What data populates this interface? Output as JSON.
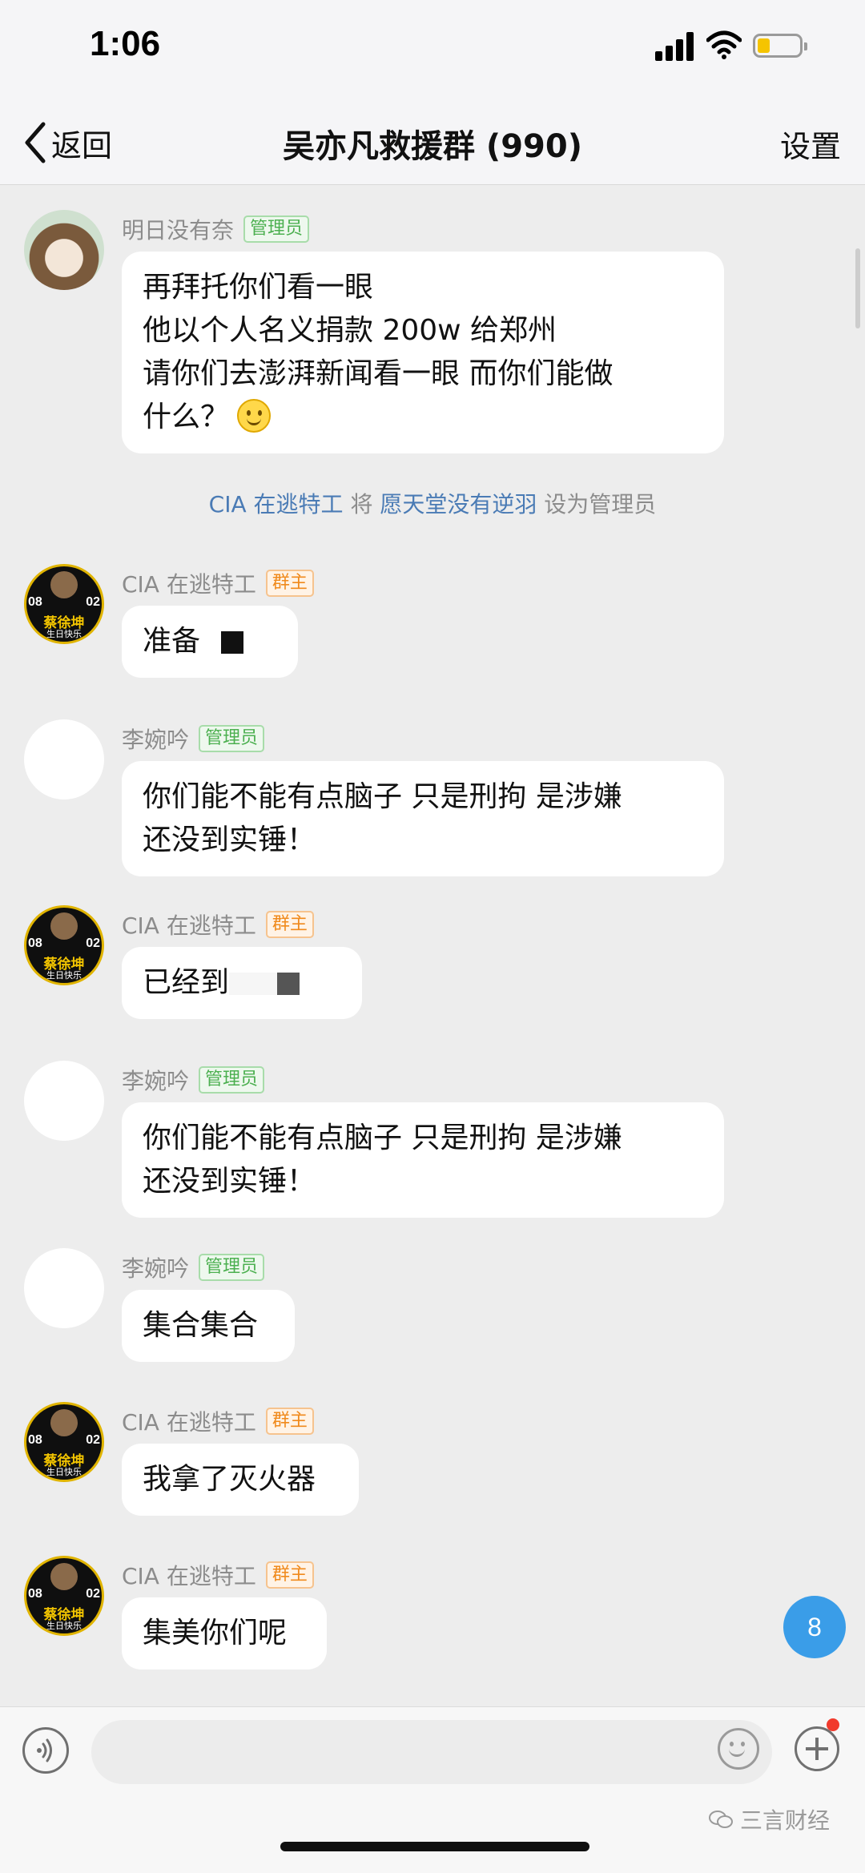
{
  "status_bar": {
    "time": "1:06"
  },
  "nav": {
    "back_label": "返回",
    "title": "吴亦凡救援群 (990)",
    "settings_label": "设置"
  },
  "badges": {
    "admin": "管理员",
    "owner": "群主"
  },
  "avatar_poster": {
    "left_num": "08",
    "right_num": "02",
    "name": "蔡徐坤",
    "sub": "生日快乐"
  },
  "messages": [
    {
      "sender": "明日没有奈",
      "role": "admin",
      "lines": [
        "再拜托你们看一眼",
        "他以个人名义捐款 200w 给郑州",
        "请你们去澎湃新闻看一眼 而你们能做",
        "什么？"
      ]
    },
    {
      "sender": "CIA 在逃特工",
      "role": "owner",
      "lines": [
        "准备"
      ]
    },
    {
      "sender": "李婉吟",
      "role": "admin",
      "lines": [
        "你们能不能有点脑子 只是刑拘 是涉嫌",
        "还没到实锤！"
      ]
    },
    {
      "sender": "CIA 在逃特工",
      "role": "owner",
      "lines": [
        "已经到"
      ]
    },
    {
      "sender": "李婉吟",
      "role": "admin",
      "lines": [
        "你们能不能有点脑子 只是刑拘 是涉嫌",
        "还没到实锤！"
      ]
    },
    {
      "sender": "李婉吟",
      "role": "admin",
      "lines": [
        "集合集合"
      ]
    },
    {
      "sender": "CIA 在逃特工",
      "role": "owner",
      "lines": [
        "我拿了灭火器"
      ]
    },
    {
      "sender": "CIA 在逃特工",
      "role": "owner",
      "lines": [
        "集美你们呢"
      ]
    }
  ],
  "system_note": {
    "actor": "CIA 在逃特工",
    "verb": "将",
    "target": "愿天堂没有逆羽",
    "action": "设为管理员"
  },
  "unread_count": "8",
  "watermark": "三言财经",
  "colors": {
    "background": "#ededed",
    "bubble": "#ffffff",
    "admin_badge": "#4cb050",
    "owner_badge": "#f08a1c",
    "link": "#4a7bb5",
    "unread": "#3a9de8"
  }
}
